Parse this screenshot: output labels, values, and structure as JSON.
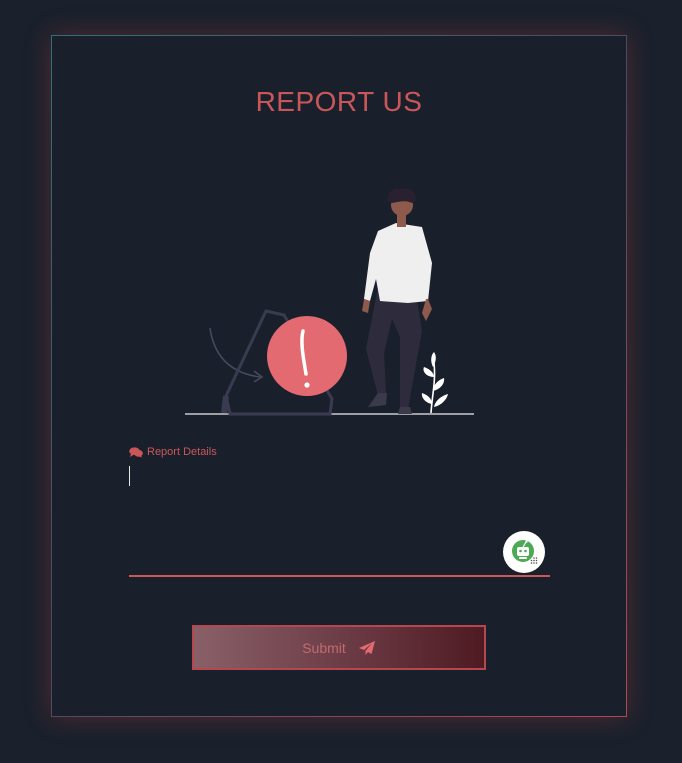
{
  "form": {
    "title": "REPORT US",
    "label": "Report Details",
    "textarea_value": "",
    "submit_label": "Submit"
  },
  "colors": {
    "accent": "#c9575a",
    "background": "#1a212c",
    "card": "#1a202b"
  },
  "icons": {
    "label_icon": "comments-icon",
    "submit_icon": "paper-plane-icon",
    "badge_icon": "robot-icon",
    "illustration": "warning-exclamation-illustration"
  }
}
